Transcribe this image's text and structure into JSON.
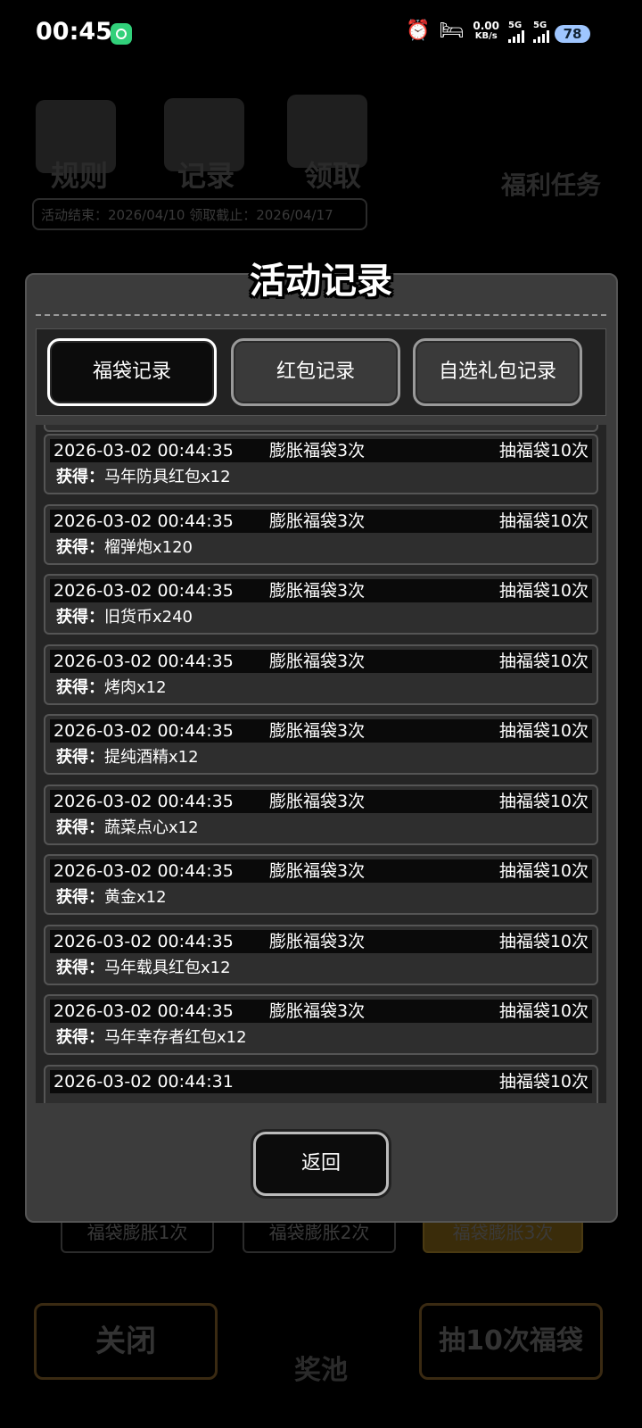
{
  "status_bar": {
    "time": "00:45",
    "network_speed_value": "0.00",
    "network_speed_unit": "KB/s",
    "signal1_label": "5G",
    "signal2_label": "5G",
    "battery": "78",
    "icons": [
      "alarm-icon",
      "bed-icon",
      "signal-icon",
      "signal-icon"
    ]
  },
  "background": {
    "rules": "规则",
    "record": "记录",
    "claim": "领取",
    "welfare": "福利任务",
    "dates": "活动结束：2026/04/10  领取截止：2026/04/17",
    "expand1": "福袋膨胀1次",
    "expand2": "福袋膨胀2次",
    "expand3": "福袋膨胀3次",
    "close": "关闭",
    "pool": "奖池",
    "draw10": "抽10次福袋"
  },
  "dialog": {
    "title": "活动记录",
    "tabs": [
      {
        "label": "福袋记录",
        "active": true
      },
      {
        "label": "红包记录",
        "active": false
      },
      {
        "label": "自选礼包记录",
        "active": false
      }
    ],
    "obtained_label": "获得：",
    "records": [
      {
        "time": "2026-03-02 00:44:35",
        "expand": "膨胀福袋3次",
        "action": "抽福袋10次",
        "item": "马年防具红包x12"
      },
      {
        "time": "2026-03-02 00:44:35",
        "expand": "膨胀福袋3次",
        "action": "抽福袋10次",
        "item": "榴弹炮x120"
      },
      {
        "time": "2026-03-02 00:44:35",
        "expand": "膨胀福袋3次",
        "action": "抽福袋10次",
        "item": "旧货币x240"
      },
      {
        "time": "2026-03-02 00:44:35",
        "expand": "膨胀福袋3次",
        "action": "抽福袋10次",
        "item": "烤肉x12"
      },
      {
        "time": "2026-03-02 00:44:35",
        "expand": "膨胀福袋3次",
        "action": "抽福袋10次",
        "item": "提纯酒精x12"
      },
      {
        "time": "2026-03-02 00:44:35",
        "expand": "膨胀福袋3次",
        "action": "抽福袋10次",
        "item": "蔬菜点心x12"
      },
      {
        "time": "2026-03-02 00:44:35",
        "expand": "膨胀福袋3次",
        "action": "抽福袋10次",
        "item": "黄金x12"
      },
      {
        "time": "2026-03-02 00:44:35",
        "expand": "膨胀福袋3次",
        "action": "抽福袋10次",
        "item": "马年载具红包x12"
      },
      {
        "time": "2026-03-02 00:44:35",
        "expand": "膨胀福袋3次",
        "action": "抽福袋10次",
        "item": "马年幸存者红包x12"
      },
      {
        "time": "2026-03-02 00:44:31",
        "expand": "",
        "action": "抽福袋10次",
        "item": ""
      }
    ],
    "back_label": "返回"
  }
}
